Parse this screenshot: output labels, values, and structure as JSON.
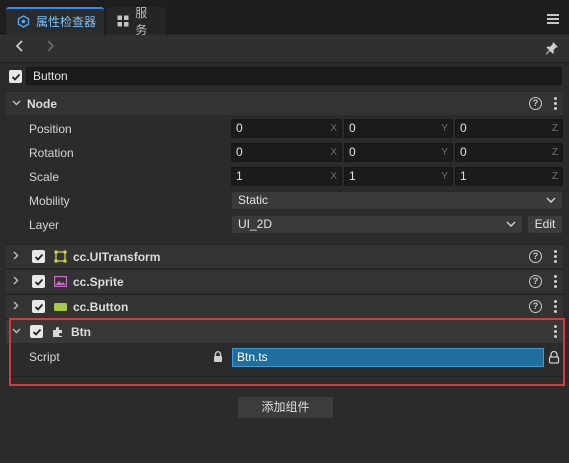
{
  "tabs": [
    {
      "label": "属性检查器",
      "icon": "inspector-icon"
    },
    {
      "label": "服务",
      "icon": "grid-icon"
    }
  ],
  "node_name": "Button",
  "node_section": {
    "title": "Node",
    "position": {
      "label": "Position",
      "x": "0",
      "y": "0",
      "z": "0"
    },
    "rotation": {
      "label": "Rotation",
      "x": "0",
      "y": "0",
      "z": "0"
    },
    "scale": {
      "label": "Scale",
      "x": "1",
      "y": "1",
      "z": "1"
    },
    "mobility": {
      "label": "Mobility",
      "value": "Static"
    },
    "layer": {
      "label": "Layer",
      "value": "UI_2D",
      "edit_label": "Edit"
    }
  },
  "axes": {
    "x": "X",
    "y": "Y",
    "z": "Z"
  },
  "components": [
    {
      "name": "cc.UITransform",
      "icon": "transform-icon"
    },
    {
      "name": "cc.Sprite",
      "icon": "sprite-icon"
    },
    {
      "name": "cc.Button",
      "icon": "button-icon"
    }
  ],
  "script_component": {
    "name": "Btn",
    "script_label": "Script",
    "script_value": "Btn.ts"
  },
  "add_component_label": "添加组件",
  "colors": {
    "accent": "#2d8ef0",
    "highlight_border": "#d63b3b",
    "script_field": "#1f6e9e"
  }
}
